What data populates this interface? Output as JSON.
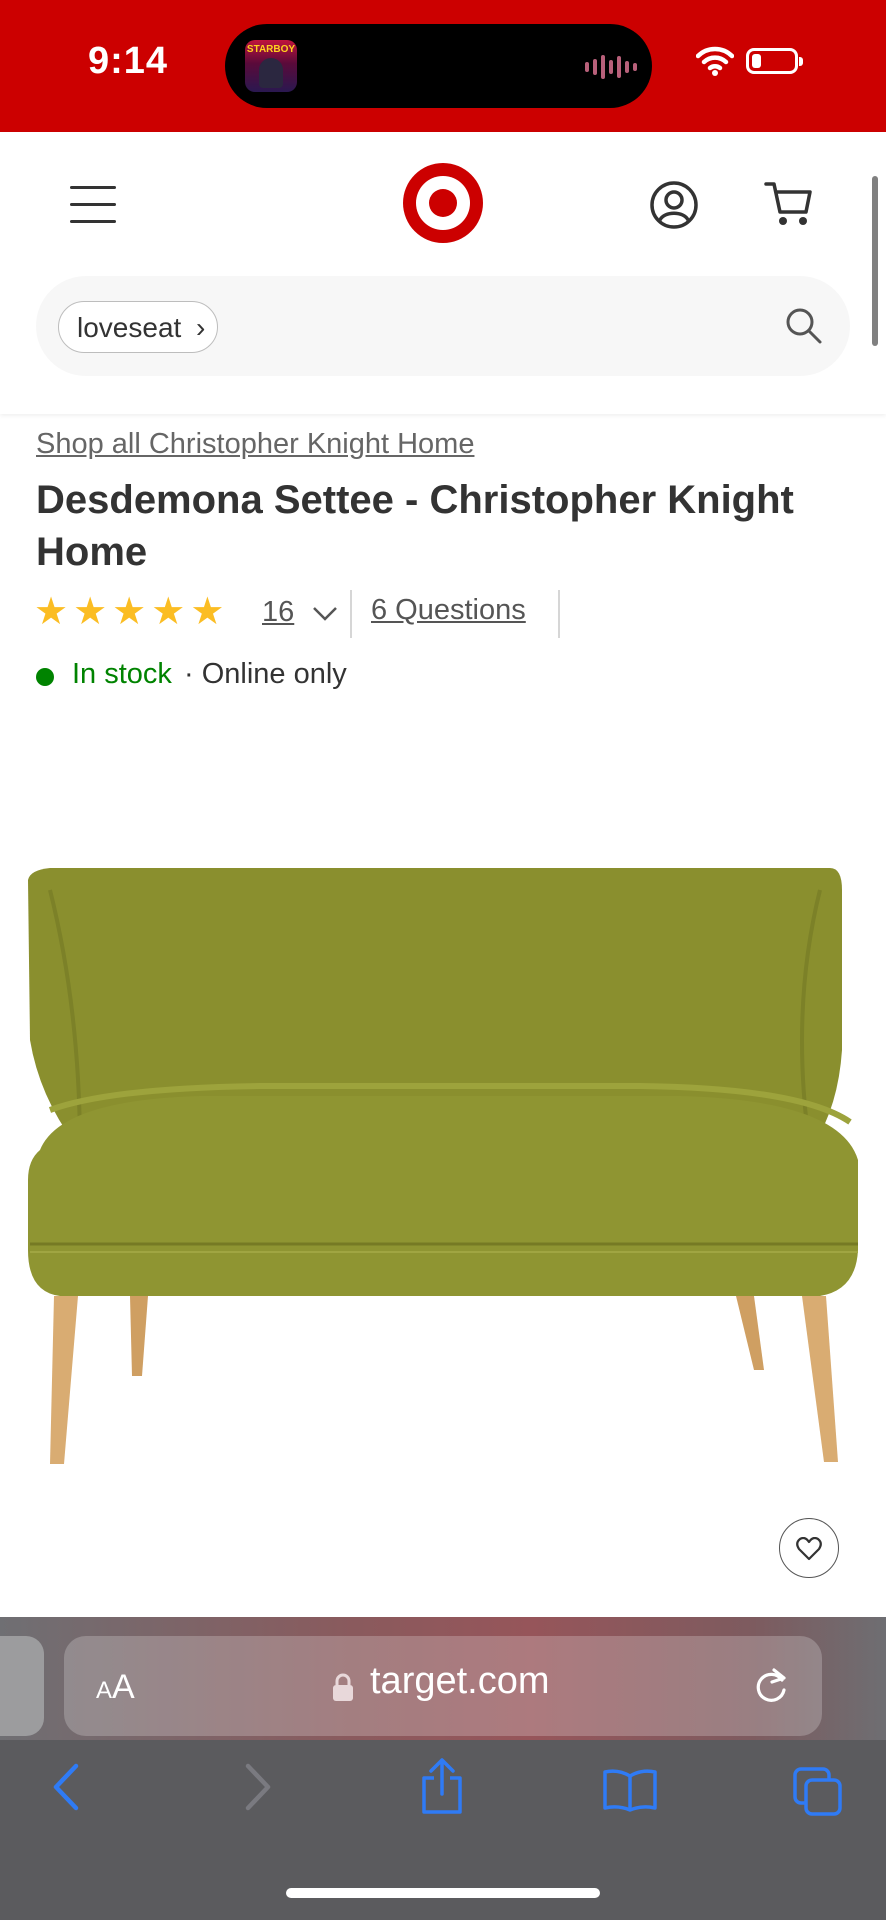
{
  "status_bar": {
    "time": "9:14",
    "now_playing_art_text": "STARBOY"
  },
  "header": {
    "brand": "Target",
    "brand_color": "#cc0000",
    "search": {
      "chip_label": "loveseat"
    }
  },
  "product": {
    "shop_all_link": "Shop all Christopher Knight Home",
    "title": "Desdemona Settee - Christopher Knight Home",
    "rating_stars": 5,
    "rating_count": "16",
    "questions_link": "6 Questions",
    "stock_status": "In stock",
    "availability": "· Online only",
    "stock_color": "#008300",
    "star_color": "#fbbd23",
    "upholstery_color": "#8a8f2e",
    "leg_color": "#d9ac72"
  },
  "browser": {
    "text_size_label_small": "A",
    "text_size_label_large": "A",
    "url": "target.com",
    "accent_color": "#2f7bf5"
  },
  "icons": [
    "menu-icon",
    "target-logo",
    "account-icon",
    "cart-icon",
    "search-icon",
    "chevron-down-icon",
    "heart-icon",
    "lock-icon",
    "reload-icon",
    "back-icon",
    "forward-icon",
    "share-icon",
    "bookmarks-icon",
    "tabs-icon"
  ]
}
